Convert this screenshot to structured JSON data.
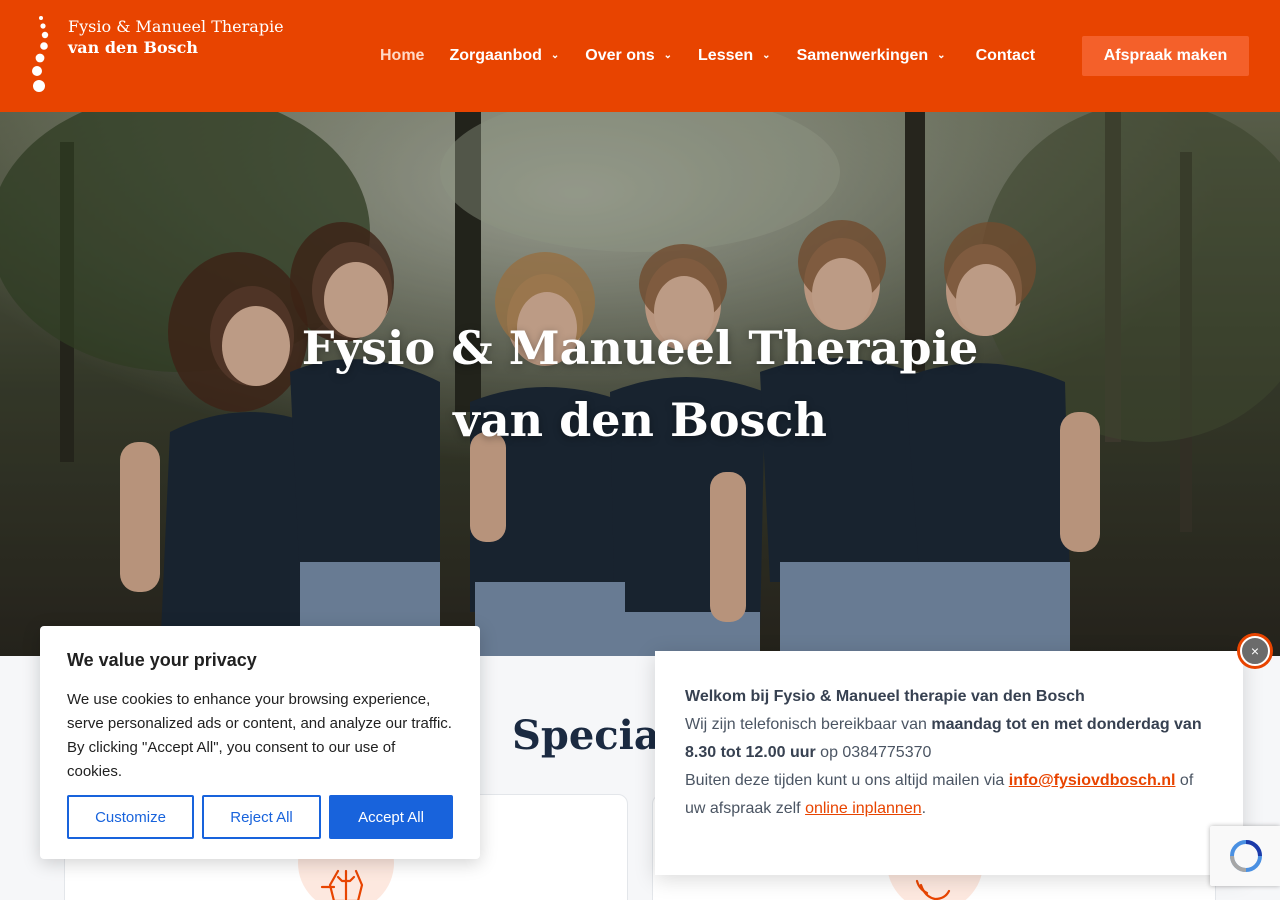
{
  "header": {
    "logo": {
      "line1": "Fysio & Manueel Therapie",
      "line2": "van den Bosch"
    },
    "nav": [
      {
        "label": "Home"
      },
      {
        "label": "Zorgaanbod"
      },
      {
        "label": "Over ons"
      },
      {
        "label": "Lessen"
      },
      {
        "label": "Samenwerkingen"
      },
      {
        "label": "Contact"
      }
    ],
    "cta_label": "Afspraak maken"
  },
  "hero": {
    "title_line1": "Fysio & Manueel Therapie",
    "title_line2": "van den Bosch"
  },
  "section": {
    "title_partial": "Speciali"
  },
  "cookie": {
    "title": "We value your privacy",
    "body": "We use cookies to enhance your browsing experience, serve personalized ads or content, and analyze our traffic. By clicking \"Accept All\", you consent to our use of cookies.",
    "customize_label": "Customize",
    "reject_label": "Reject All",
    "accept_label": "Accept All"
  },
  "popup": {
    "welcome": "Welkom bij Fysio & Manueel therapie van den Bosch",
    "phone_intro": "Wij zijn telefonisch bereikbaar van ",
    "phone_hours": "maandag tot en met donderdag van 8.30 tot 12.00 uur",
    "phone_on": " op ",
    "phone_number": "0384775370",
    "mail_intro": "Buiten deze tijden kunt u ons altijd mailen via ",
    "mail_address": "info@fysiovdbosch.nl",
    "mail_or": " of uw afspraak zelf ",
    "online_link": "online inplannen",
    "period": ".",
    "close_symbol": "×"
  },
  "colors": {
    "brand_orange": "#e84400",
    "cta_orange": "#f4602a",
    "cookie_blue": "#1863dc"
  }
}
